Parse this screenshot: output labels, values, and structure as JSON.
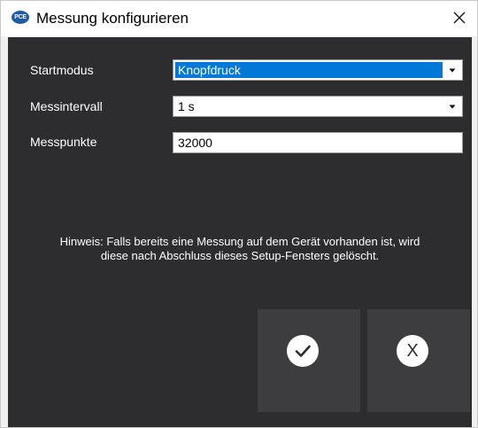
{
  "window": {
    "title": "Messung konfigurieren",
    "app_icon_text": "PCE",
    "icons": {
      "app": "pce-logo-icon",
      "close": "close-icon"
    }
  },
  "form": {
    "startmodus": {
      "label": "Startmodus",
      "value": "Knopfdruck"
    },
    "messintervall": {
      "label": "Messintervall",
      "value": "1 s"
    },
    "messpunkte": {
      "label": "Messpunkte",
      "value": "32000"
    }
  },
  "hint": {
    "line1": "Hinweis: Falls bereits eine Messung auf dem Gerät vorhanden ist, wird",
    "line2": "diese nach Abschluss dieses Setup-Fensters gelöscht."
  },
  "buttons": {
    "confirm_icon": "checkmark-icon",
    "cancel_label": "X"
  },
  "colors": {
    "panel_bg": "#2d2d30",
    "button_bg": "#3d3d40",
    "selection": "#0078d7"
  }
}
